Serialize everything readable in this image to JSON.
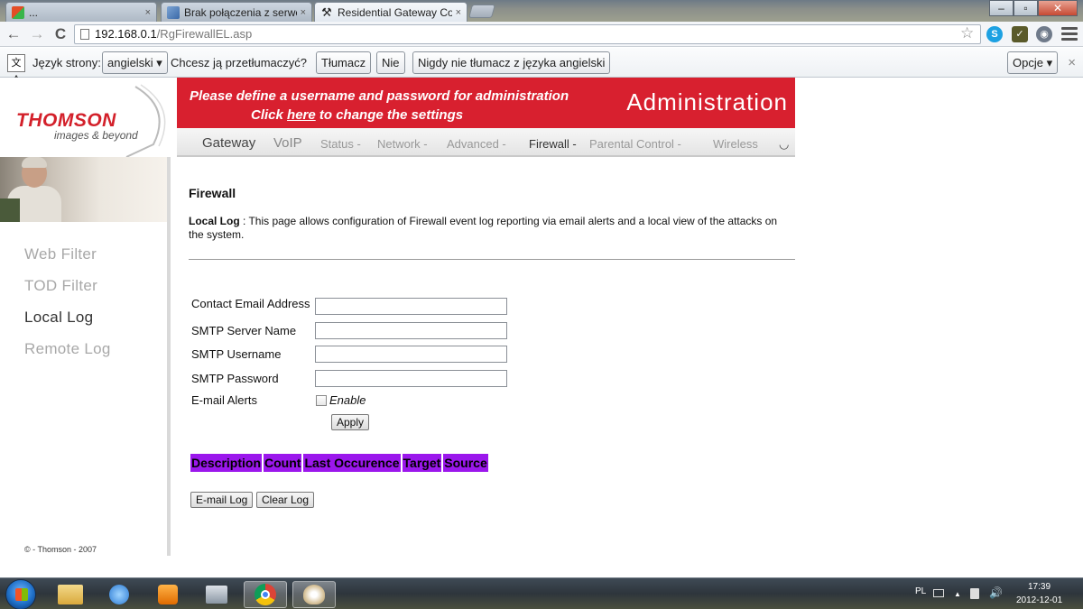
{
  "browser": {
    "tabs": [
      {
        "label": "...",
        "close": "×"
      },
      {
        "label": "Brak połączenia z serwerar",
        "close": "×"
      },
      {
        "label": "Residential Gateway Confi",
        "close": "×"
      }
    ],
    "window_controls": {
      "minimize": "–",
      "maximize": "▫",
      "close": "✕"
    },
    "url": {
      "host": "192.168.0.1",
      "path": "/RgFirewallEL.asp"
    },
    "nav": {
      "back": "←",
      "forward": "→",
      "reload": "C"
    },
    "star": "☆",
    "extensions": [
      {
        "name": "skype-icon",
        "glyph": "S",
        "color": "#1da1e2"
      },
      {
        "name": "extension-icon",
        "glyph": "✓",
        "color": "#5a5a2a"
      },
      {
        "name": "eye-icon",
        "glyph": "◉",
        "color": "#6f7a8a"
      }
    ]
  },
  "translate_bar": {
    "label_language": "Język strony:",
    "language": "angielski ▾",
    "question": "Chcesz ją przetłumaczyć?",
    "translate": "Tłumacz",
    "no": "Nie",
    "never": "Nigdy nie tłumacz z języka angielski",
    "options": "Opcje ▾",
    "close": "×"
  },
  "header": {
    "logo": "THOMSON",
    "tagline": "images & beyond",
    "banner_line1": "Please define a username and password for administration",
    "banner_line2_pre": "Click ",
    "banner_line2_link": "here",
    "banner_line2_post": " to change the settings",
    "title": "Administration"
  },
  "nav": {
    "gateway": "Gateway",
    "voip": "VoIP",
    "status": "Status -",
    "network": "Network -",
    "advanced": "Advanced -",
    "firewall": "Firewall -",
    "parental": "Parental Control -",
    "wireless": "Wireless",
    "spinner": "◡"
  },
  "sidebar": {
    "items": [
      {
        "label": "Web Filter"
      },
      {
        "label": "TOD Filter"
      },
      {
        "label": "Local Log"
      },
      {
        "label": "Remote Log"
      }
    ],
    "copyright": "© - Thomson - 2007"
  },
  "main": {
    "heading": "Firewall",
    "desc_label": "Local Log",
    "desc_text": "  :  This page allows configuration of Firewall event log reporting via email alerts and a local view of the attacks on the system.",
    "fields": [
      {
        "label": "Contact Email Address",
        "value": ""
      },
      {
        "label": "SMTP Server Name",
        "value": ""
      },
      {
        "label": "SMTP Username",
        "value": ""
      },
      {
        "label": "SMTP Password",
        "value": ""
      }
    ],
    "email_alerts_label": "E-mail Alerts",
    "enable_label": "Enable",
    "apply": "Apply",
    "log_columns": [
      "Description",
      "Count",
      "Last Occurence",
      "Target",
      "Source"
    ],
    "email_log": "E-mail Log",
    "clear_log": "Clear Log"
  },
  "taskbar": {
    "lang": "PL",
    "time": "17:39",
    "date": "2012-12-01",
    "tray_up": "▲",
    "volume": "🔊"
  }
}
